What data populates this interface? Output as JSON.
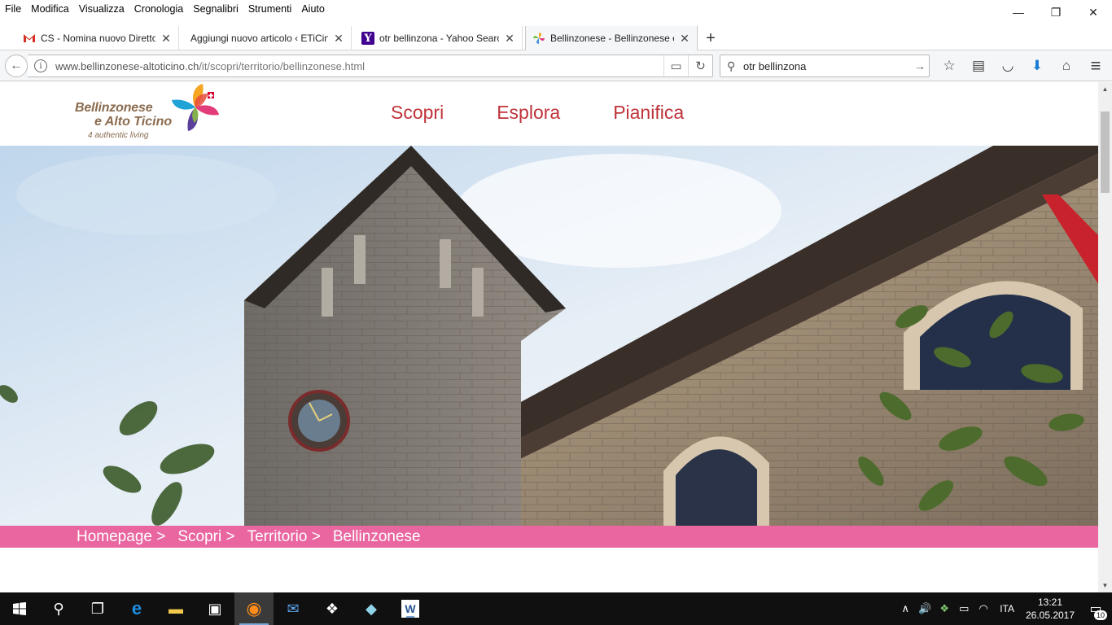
{
  "menubar": {
    "items": [
      "File",
      "Modifica",
      "Visualizza",
      "Cronologia",
      "Segnalibri",
      "Strumenti",
      "Aiuto"
    ]
  },
  "window_controls": {
    "minimize": "—",
    "restore": "❐",
    "close": "✕"
  },
  "tabs": [
    {
      "title": "CS - Nomina nuovo Direttore",
      "favicon": "gmail-icon",
      "close": "✕"
    },
    {
      "title": "Aggiungi nuovo articolo ‹ ETiCinema",
      "favicon": "wordpress-icon",
      "close": "✕"
    },
    {
      "title": "otr bellinzona - Yahoo Search",
      "favicon": "yahoo-icon",
      "favicon_text": "Y",
      "close": "✕"
    },
    {
      "title": "Bellinzonese - Bellinzonese e Alto Ticino",
      "favicon": "pinwheel-icon",
      "close": "✕",
      "active": true
    }
  ],
  "newtab_label": "+",
  "navbar": {
    "back_icon": "←",
    "info_icon": "i",
    "url_host": "www.bellinzonese-altoticino.ch",
    "url_path": "/it/scopri/territorio/bellinzonese.html",
    "reader_icon": "▭",
    "reload_icon": "↻",
    "search_value": "otr bellinzona",
    "search_icon": "⚲",
    "search_go_icon": "→",
    "toolbar_icons": [
      {
        "name": "bookmark-star-icon",
        "glyph": "☆"
      },
      {
        "name": "library-icon",
        "glyph": "▤"
      },
      {
        "name": "pocket-icon",
        "glyph": "◡"
      },
      {
        "name": "downloads-icon",
        "glyph": "⬇"
      },
      {
        "name": "home-icon",
        "glyph": "⌂"
      },
      {
        "name": "hamburger-menu-icon",
        "glyph": "≡"
      }
    ]
  },
  "site": {
    "logo_line1": "Bellinzonese",
    "logo_line2": "e Alto Ticino",
    "logo_tagline": "4 authentic living",
    "nav": [
      "Scopri",
      "Esplora",
      "Pianifica"
    ],
    "breadcrumb": [
      "Homepage >",
      "Scopri >",
      "Territorio >",
      "Bellinzonese"
    ],
    "colors": {
      "nav_red": "#c0333a",
      "breadcrumb_pink": "#e966a0",
      "logo_brown": "#8b6b4e"
    }
  },
  "scrollbar": {
    "up": "▲",
    "down": "▼"
  },
  "taskbar": {
    "start_icon": "windows-start-icon",
    "apps": [
      {
        "name": "search-icon",
        "glyph": "⚲"
      },
      {
        "name": "task-view-icon",
        "glyph": "❐"
      },
      {
        "name": "edge-icon",
        "glyph": "e"
      },
      {
        "name": "file-explorer-icon",
        "glyph": "▬"
      },
      {
        "name": "store-icon",
        "glyph": "▣"
      },
      {
        "name": "firefox-icon",
        "glyph": "◉"
      },
      {
        "name": "outlook-icon",
        "glyph": "✉"
      },
      {
        "name": "dropbox-icon",
        "glyph": "❖"
      },
      {
        "name": "app-icon",
        "glyph": "◆"
      },
      {
        "name": "word-icon",
        "glyph": "W"
      }
    ],
    "tray": {
      "chevron": "∧",
      "volume": "🔊",
      "dropbox": "❖",
      "battery": "▭",
      "wifi": "◠",
      "language": "ITA",
      "time": "13:21",
      "date": "26.05.2017",
      "notifications_count": "10",
      "notification_icon": "▭"
    }
  }
}
